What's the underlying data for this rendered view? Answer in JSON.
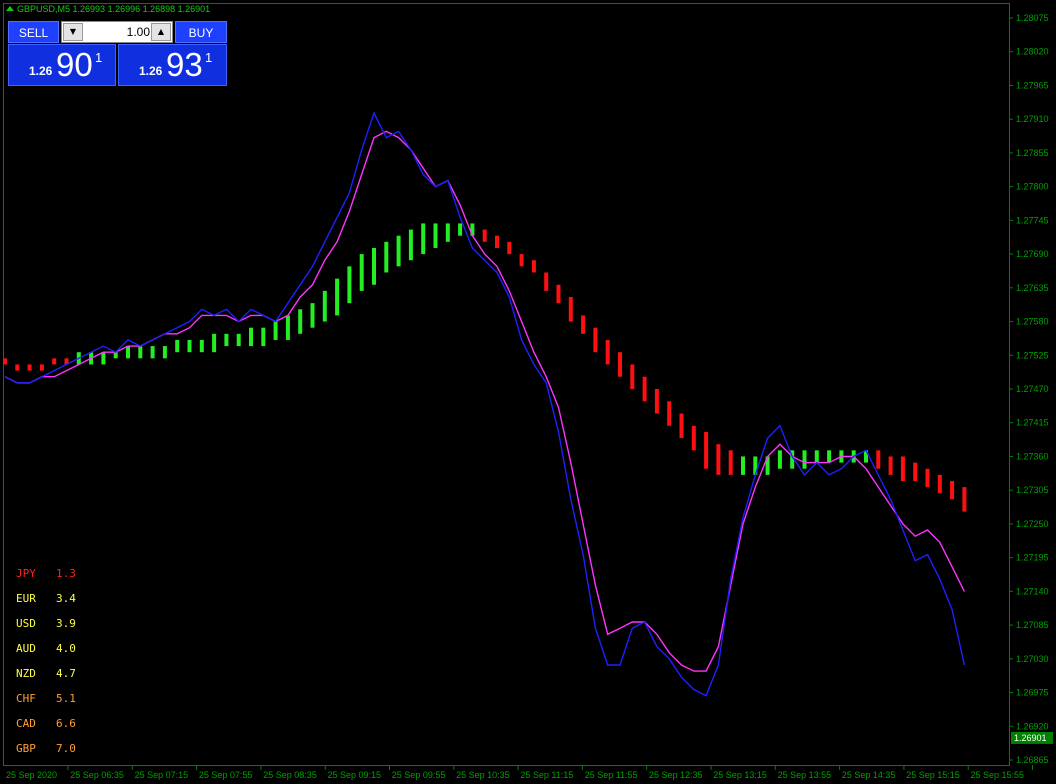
{
  "header": {
    "symbol": "GBPUSD,M5",
    "ohlc": "1.26993 1.26996 1.26898 1.26901"
  },
  "trade_panel": {
    "sell_label": "SELL",
    "buy_label": "BUY",
    "lot_value": "1.00",
    "sell_price": {
      "prefix": "1.26",
      "big": "90",
      "sup": "1"
    },
    "buy_price": {
      "prefix": "1.26",
      "big": "93",
      "sup": "1"
    }
  },
  "price_axis": {
    "labels": [
      "1.28075",
      "1.28020",
      "1.27965",
      "1.27910",
      "1.27855",
      "1.27800",
      "1.27745",
      "1.27690",
      "1.27635",
      "1.27580",
      "1.27525",
      "1.27470",
      "1.27415",
      "1.27360",
      "1.27305",
      "1.27250",
      "1.27195",
      "1.27140",
      "1.27085",
      "1.27030",
      "1.26975",
      "1.26920",
      "1.26865"
    ],
    "current_price": "1.26901",
    "current_price_color": "#008000"
  },
  "time_axis": {
    "labels": [
      "25 Sep 2020",
      "25 Sep 06:35",
      "25 Sep 07:15",
      "25 Sep 07:55",
      "25 Sep 08:35",
      "25 Sep 09:15",
      "25 Sep 09:55",
      "25 Sep 10:35",
      "25 Sep 11:15",
      "25 Sep 11:55",
      "25 Sep 12:35",
      "25 Sep 13:15",
      "25 Sep 13:55",
      "25 Sep 14:35",
      "25 Sep 15:15",
      "25 Sep 15:55"
    ]
  },
  "currency_strength": [
    {
      "currency": "JPY",
      "value": "1.3",
      "color": "#ff2020"
    },
    {
      "currency": "EUR",
      "value": "3.4",
      "color": "#ffff40"
    },
    {
      "currency": "USD",
      "value": "3.9",
      "color": "#ffff40"
    },
    {
      "currency": "AUD",
      "value": "4.0",
      "color": "#ffff40"
    },
    {
      "currency": "NZD",
      "value": "4.7",
      "color": "#ffff40"
    },
    {
      "currency": "CHF",
      "value": "5.1",
      "color": "#ffa030"
    },
    {
      "currency": "CAD",
      "value": "6.6",
      "color": "#ffa030"
    },
    {
      "currency": "GBP",
      "value": "7.0",
      "color": "#ffa030"
    }
  ],
  "colors": {
    "background": "#000000",
    "frame": "#008000",
    "fast_line": "#ff33ff",
    "slow_line": "#2020ff",
    "ribbon_up": "#22ee22",
    "ribbon_down": "#ff1010"
  },
  "chart_data": {
    "type": "line",
    "x_start": "25 Sep 2020 05:55",
    "x_step_minutes": 5,
    "ylim": [
      1.26865,
      1.28075
    ],
    "series": [
      {
        "values": [
          1.2749,
          1.2748,
          1.2748,
          1.2749,
          1.275,
          1.2751,
          1.2752,
          1.2753,
          1.2754,
          1.2753,
          1.2755,
          1.2754,
          1.2755,
          1.2756,
          1.2757,
          1.2758,
          1.276,
          1.2759,
          1.276,
          1.2758,
          1.276,
          1.2759,
          1.2758,
          1.2761,
          1.2764,
          1.2767,
          1.2771,
          1.2775,
          1.2779,
          1.2786,
          1.2792,
          1.2788,
          1.2789,
          1.2786,
          1.2782,
          1.278,
          1.2781,
          1.2775,
          1.277,
          1.2768,
          1.2766,
          1.2762,
          1.2755,
          1.2751,
          1.2748,
          1.274,
          1.2729,
          1.272,
          1.2708,
          1.2702,
          1.2702,
          1.2708,
          1.2709,
          1.2705,
          1.2703,
          1.27,
          1.2698,
          1.2697,
          1.2702,
          1.2716,
          1.2726,
          1.2733,
          1.2739,
          1.2741,
          1.2736,
          1.2733,
          1.2735,
          1.2733,
          1.2734,
          1.2736,
          1.2737,
          1.2733,
          1.2729,
          1.2724,
          1.2719,
          1.272,
          1.2716,
          1.2711,
          1.2702
        ]
      },
      {
        "values": [
          1.2749,
          1.2748,
          1.2748,
          1.2749,
          1.2749,
          1.275,
          1.2751,
          1.2752,
          1.2753,
          1.2753,
          1.2754,
          1.2754,
          1.2755,
          1.2756,
          1.2756,
          1.2757,
          1.2759,
          1.2759,
          1.2759,
          1.2758,
          1.2759,
          1.2759,
          1.2758,
          1.2759,
          1.2762,
          1.2764,
          1.2768,
          1.2771,
          1.2776,
          1.2782,
          1.2788,
          1.2789,
          1.2788,
          1.2786,
          1.2783,
          1.278,
          1.2781,
          1.2777,
          1.2772,
          1.2769,
          1.2767,
          1.2763,
          1.2758,
          1.2753,
          1.2749,
          1.2744,
          1.2735,
          1.2725,
          1.2715,
          1.2707,
          1.2708,
          1.2709,
          1.2709,
          1.2707,
          1.2704,
          1.2702,
          1.2701,
          1.2701,
          1.2705,
          1.2715,
          1.2725,
          1.2731,
          1.2736,
          1.2738,
          1.2736,
          1.2735,
          1.2735,
          1.2735,
          1.2736,
          1.2736,
          1.2734,
          1.2731,
          1.2728,
          1.2725,
          1.2723,
          1.2724,
          1.2722,
          1.2718,
          1.2714
        ]
      }
    ],
    "ribbon": {
      "values_top": [
        1.2752,
        1.2751,
        1.2751,
        1.2751,
        1.2752,
        1.2752,
        1.2753,
        1.2753,
        1.2753,
        1.2753,
        1.2754,
        1.2754,
        1.2754,
        1.2754,
        1.2755,
        1.2755,
        1.2755,
        1.2756,
        1.2756,
        1.2756,
        1.2757,
        1.2757,
        1.2758,
        1.2759,
        1.276,
        1.2761,
        1.2763,
        1.2765,
        1.2767,
        1.2769,
        1.277,
        1.2771,
        1.2772,
        1.2773,
        1.2774,
        1.2774,
        1.2774,
        1.2774,
        1.2774,
        1.2773,
        1.2772,
        1.2771,
        1.2769,
        1.2768,
        1.2766,
        1.2764,
        1.2762,
        1.2759,
        1.2757,
        1.2755,
        1.2753,
        1.2751,
        1.2749,
        1.2747,
        1.2745,
        1.2743,
        1.2741,
        1.274,
        1.2738,
        1.2737,
        1.2736,
        1.2736,
        1.2736,
        1.2737,
        1.2737,
        1.2737,
        1.2737,
        1.2737,
        1.2737,
        1.2737,
        1.2737,
        1.2737,
        1.2736,
        1.2736,
        1.2735,
        1.2734,
        1.2733,
        1.2732,
        1.2731
      ],
      "values_bottom": [
        1.2751,
        1.275,
        1.275,
        1.275,
        1.2751,
        1.2751,
        1.2751,
        1.2751,
        1.2751,
        1.2752,
        1.2752,
        1.2752,
        1.2752,
        1.2752,
        1.2753,
        1.2753,
        1.2753,
        1.2753,
        1.2754,
        1.2754,
        1.2754,
        1.2754,
        1.2755,
        1.2755,
        1.2756,
        1.2757,
        1.2758,
        1.2759,
        1.2761,
        1.2763,
        1.2764,
        1.2766,
        1.2767,
        1.2768,
        1.2769,
        1.277,
        1.2771,
        1.2772,
        1.2772,
        1.2771,
        1.277,
        1.2769,
        1.2767,
        1.2766,
        1.2763,
        1.2761,
        1.2758,
        1.2756,
        1.2753,
        1.2751,
        1.2749,
        1.2747,
        1.2745,
        1.2743,
        1.2741,
        1.2739,
        1.2737,
        1.2734,
        1.2733,
        1.2733,
        1.2733,
        1.2733,
        1.2733,
        1.2734,
        1.2734,
        1.2734,
        1.2735,
        1.2735,
        1.2735,
        1.2735,
        1.2735,
        1.2734,
        1.2733,
        1.2732,
        1.2732,
        1.2731,
        1.273,
        1.2729,
        1.2727
      ],
      "direction": [
        "down",
        "down",
        "down",
        "down",
        "down",
        "down",
        "up",
        "up",
        "up",
        "up",
        "up",
        "up",
        "up",
        "up",
        "up",
        "up",
        "up",
        "up",
        "up",
        "up",
        "up",
        "up",
        "up",
        "up",
        "up",
        "up",
        "up",
        "up",
        "up",
        "up",
        "up",
        "up",
        "up",
        "up",
        "up",
        "up",
        "up",
        "up",
        "up",
        "down",
        "down",
        "down",
        "down",
        "down",
        "down",
        "down",
        "down",
        "down",
        "down",
        "down",
        "down",
        "down",
        "down",
        "down",
        "down",
        "down",
        "down",
        "down",
        "down",
        "down",
        "up",
        "up",
        "up",
        "up",
        "up",
        "up",
        "up",
        "up",
        "up",
        "up",
        "up",
        "down",
        "down",
        "down",
        "down",
        "down",
        "down",
        "down",
        "down"
      ]
    }
  }
}
